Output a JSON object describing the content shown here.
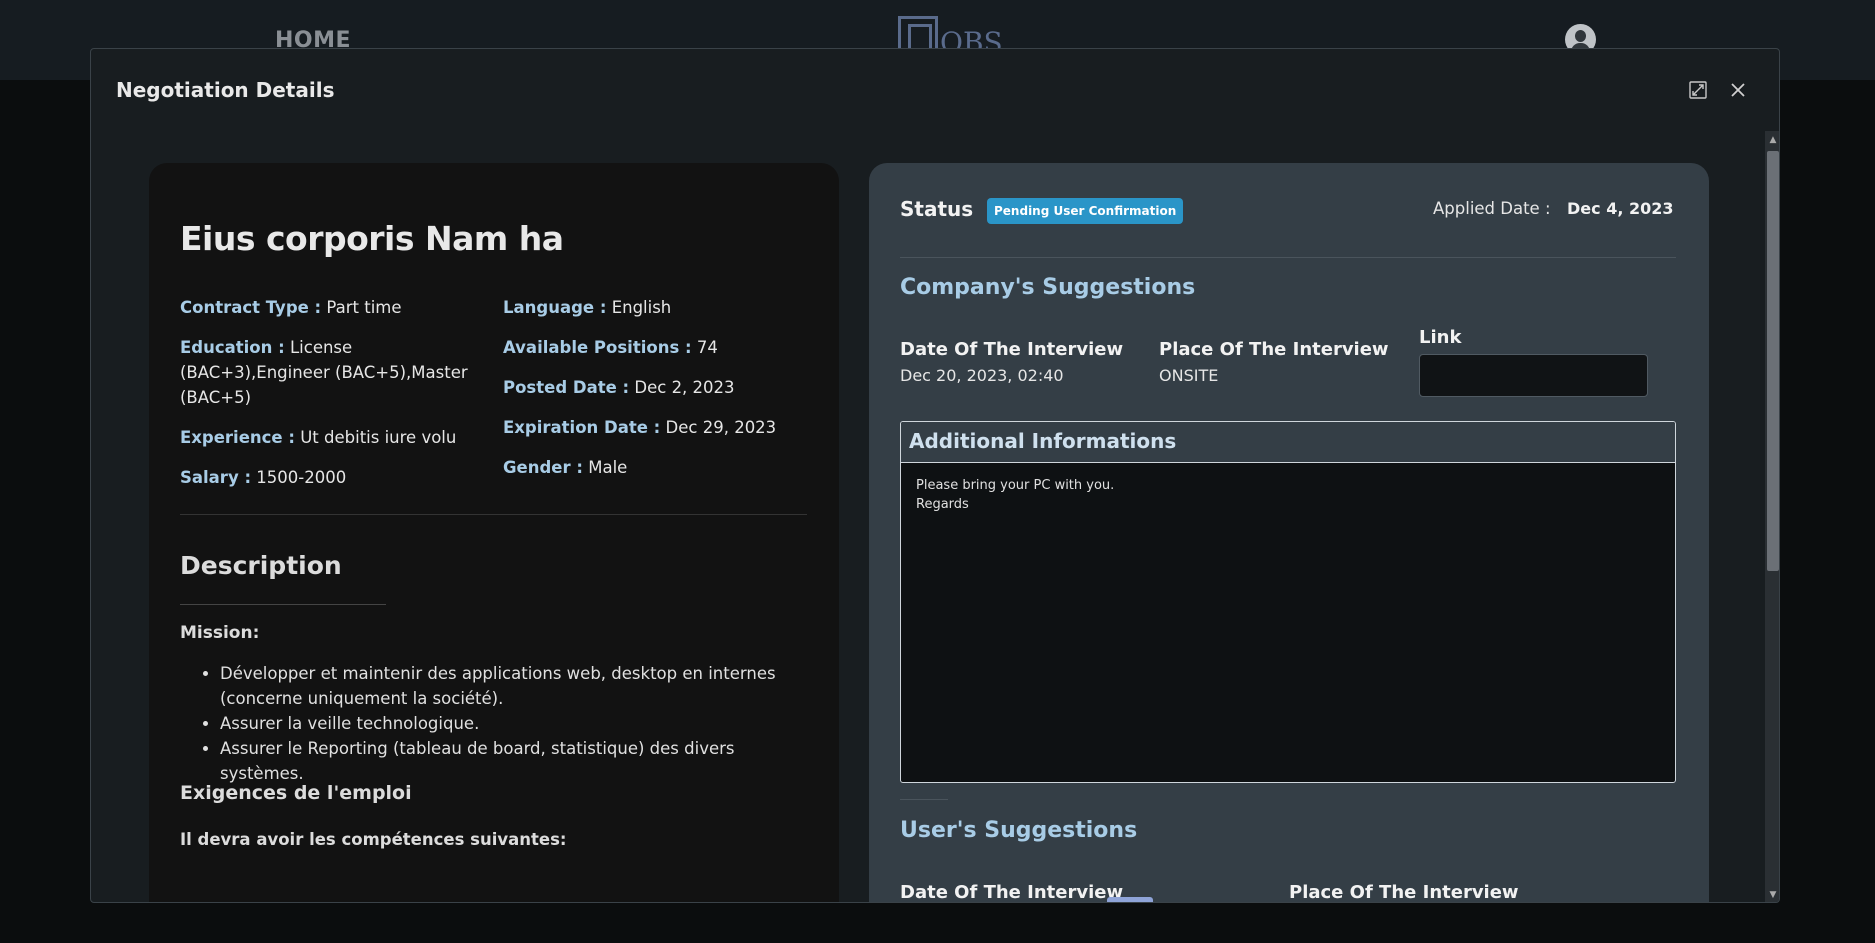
{
  "nav": {
    "home_label": "HOME",
    "logo_text": "OBS"
  },
  "modal": {
    "title": "Negotiation Details"
  },
  "job": {
    "title": "Eius corporis Nam ha",
    "contract_type_key": "Contract Type :",
    "contract_type": "Part time",
    "education_key": "Education :",
    "education": "License (BAC+3),Engineer (BAC+5),Master (BAC+5)",
    "experience_key": "Experience :",
    "experience": "Ut debitis iure volu",
    "salary_key": "Salary :",
    "salary": "1500-2000",
    "language_key": "Language :",
    "language": "English",
    "positions_key": "Available Positions :",
    "positions": "74",
    "posted_key": "Posted Date :",
    "posted": "Dec 2, 2023",
    "expiration_key": "Expiration Date :",
    "expiration": "Dec 29, 2023",
    "gender_key": "Gender :",
    "gender": "Male"
  },
  "description": {
    "title": "Description",
    "mission_label": "Mission:",
    "mission_items": [
      "Développer et maintenir des applications web, desktop en internes (concerne uniquement la société).",
      "Assurer la veille technologique.",
      "Assurer le Reporting (tableau de board, statistique) des divers systèmes."
    ],
    "requirements_title": "Exigences de l'emploi",
    "requirements_sub": "Il devra avoir les compétences suivantes:"
  },
  "status": {
    "label": "Status",
    "badge": "Pending User Confirmation",
    "badge_color": "#2a95c8",
    "applied_label": "Applied Date :",
    "applied_value": "Dec 4, 2023"
  },
  "company": {
    "title": "Company's Suggestions",
    "date_label": "Date Of The Interview",
    "date_value": "Dec 20, 2023, 02:40",
    "place_label": "Place Of The Interview",
    "place_value": "ONSITE",
    "link_label": "Link",
    "link_value": ""
  },
  "additional": {
    "title": "Additional Informations",
    "text": "Please bring your PC with you.\nRegards"
  },
  "user": {
    "title": "User's Suggestions",
    "date_label": "Date Of The Interview",
    "place_label": "Place Of The Interview"
  }
}
